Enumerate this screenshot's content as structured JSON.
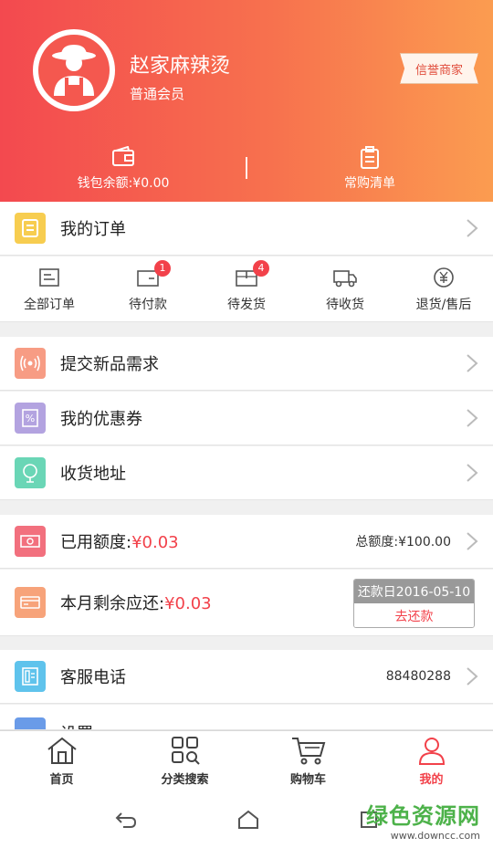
{
  "profile": {
    "name": "赵家麻辣烫",
    "level": "普通会员",
    "badge": "信誉商家",
    "wallet_label": "钱包余额:¥0.00",
    "frequent_label": "常购清单"
  },
  "my_orders": {
    "label": "我的订单"
  },
  "order_tabs": [
    {
      "label": "全部订单",
      "icon": "list-icon",
      "count": ""
    },
    {
      "label": "待付款",
      "icon": "payment-icon",
      "count": "1"
    },
    {
      "label": "待发货",
      "icon": "box-icon",
      "count": "4"
    },
    {
      "label": "待收货",
      "icon": "truck-icon",
      "count": ""
    },
    {
      "label": "退货/售后",
      "icon": "yuan-return-icon",
      "count": ""
    }
  ],
  "menu": {
    "new_product": "提交新品需求",
    "coupons": "我的优惠券",
    "address": "收货地址"
  },
  "credit": {
    "used_label": "已用额度:",
    "used_value": "¥0.03",
    "total": "总额度:¥100.00",
    "remaining_label": "本月剩余应还:",
    "remaining_value": "¥0.03",
    "due_date": "还款日2016-05-10",
    "repay_button": "去还款"
  },
  "service": {
    "label": "客服电话",
    "phone": "88480288"
  },
  "settings": {
    "label": "设置"
  },
  "tabs": [
    {
      "label": "首页",
      "icon": "home-icon"
    },
    {
      "label": "分类搜索",
      "icon": "category-search-icon"
    },
    {
      "label": "购物车",
      "icon": "cart-icon"
    },
    {
      "label": "我的",
      "icon": "user-icon"
    }
  ],
  "watermark": {
    "line1": "绿色资源网",
    "line2": "www.downcc.com"
  },
  "colors": {
    "accent": "#f2414a",
    "header_start": "#f3494f",
    "header_end": "#fb9c50"
  }
}
